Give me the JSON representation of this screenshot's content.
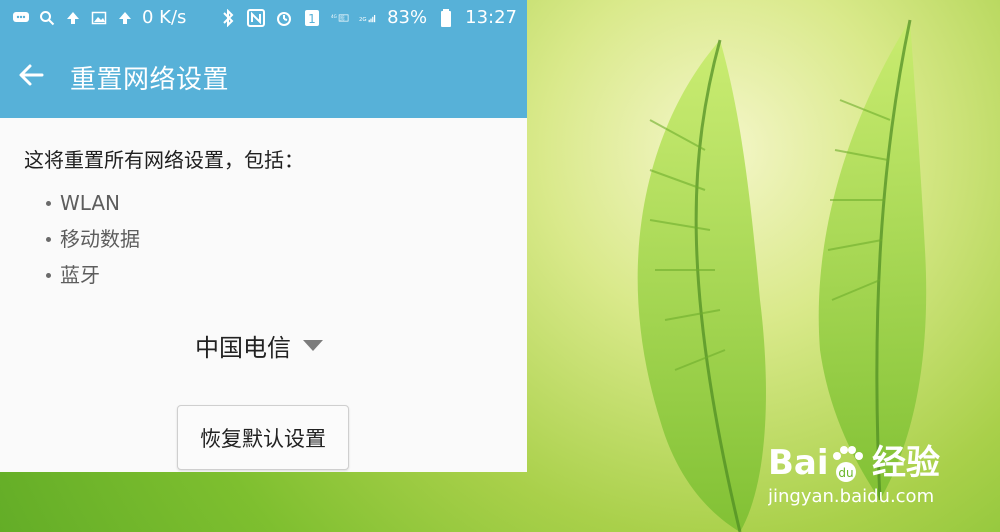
{
  "status_bar": {
    "speed": "0 K/s",
    "battery": "83%",
    "time": "13:27",
    "sim_badge": "1",
    "net_4g": "4G",
    "net_4g_2g": "4G\n2G",
    "net_2g": "2G"
  },
  "app_bar": {
    "title": "重置网络设置"
  },
  "content": {
    "description": "这将重置所有网络设置，包括：",
    "bullets": [
      "WLAN",
      "移动数据",
      "蓝牙"
    ]
  },
  "sim_select": {
    "value": "中国电信"
  },
  "reset_button": {
    "label": "恢复默认设置"
  },
  "watermark": {
    "brand": "Bai",
    "brand_suffix": "经验",
    "url": "jingyan.baidu.com"
  },
  "colors": {
    "accent": "#57b1d8",
    "leaf_green": "#8fcf3c"
  },
  "icons": {
    "status_left": [
      "message-icon",
      "search-icon",
      "upload-icon",
      "image-icon",
      "upload-icon"
    ],
    "status_right": [
      "bluetooth-icon",
      "nfc-icon",
      "alarm-icon",
      "sim-icon",
      "signal-icon",
      "battery-icon"
    ],
    "app_bar": [
      "back-arrow-icon"
    ],
    "dropdown": [
      "caret-down-icon"
    ]
  }
}
